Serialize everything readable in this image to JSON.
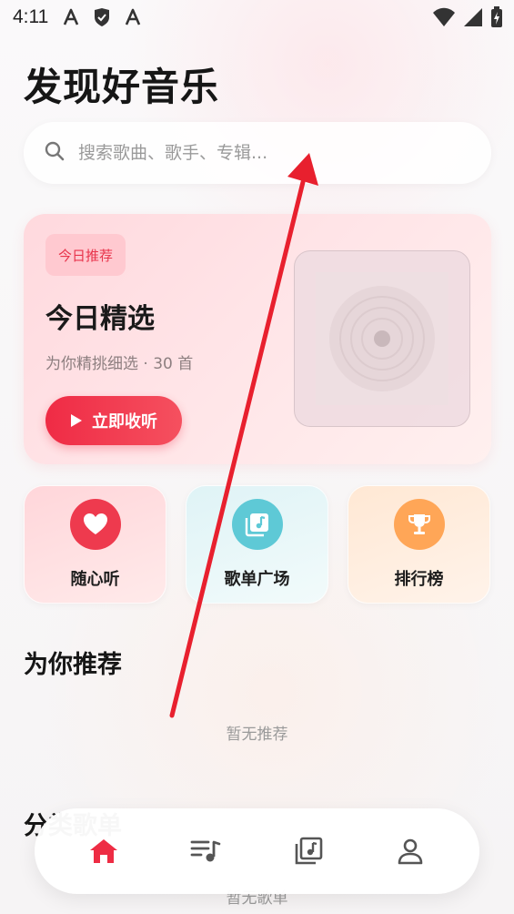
{
  "status_bar": {
    "time": "4:11"
  },
  "header": {
    "title": "发现好音乐"
  },
  "search": {
    "placeholder": "搜索歌曲、歌手、专辑..."
  },
  "today_card": {
    "badge": "今日推荐",
    "title": "今日精选",
    "subtitle": "为你精挑细选 · 30 首",
    "play_label": "立即收听"
  },
  "quick_entries": [
    {
      "label": "随心听",
      "icon": "heart-icon",
      "color": "#ee3a4e"
    },
    {
      "label": "歌单广场",
      "icon": "album-icon",
      "color": "#5ec9d6"
    },
    {
      "label": "排行榜",
      "icon": "trophy-icon",
      "color": "#ffa657"
    }
  ],
  "sections": {
    "recommend_title": "为你推荐",
    "recommend_empty": "暂无推荐",
    "category_title": "分类歌单",
    "category_empty": "暂无歌单"
  },
  "bottom_nav": {
    "items": [
      {
        "icon": "home-icon",
        "active": true
      },
      {
        "icon": "playlist-icon",
        "active": false
      },
      {
        "icon": "library-icon",
        "active": false
      },
      {
        "icon": "profile-icon",
        "active": false
      }
    ],
    "active_color": "#ee2c44",
    "inactive_color": "#555555"
  },
  "accent_color": "#ef2b45"
}
